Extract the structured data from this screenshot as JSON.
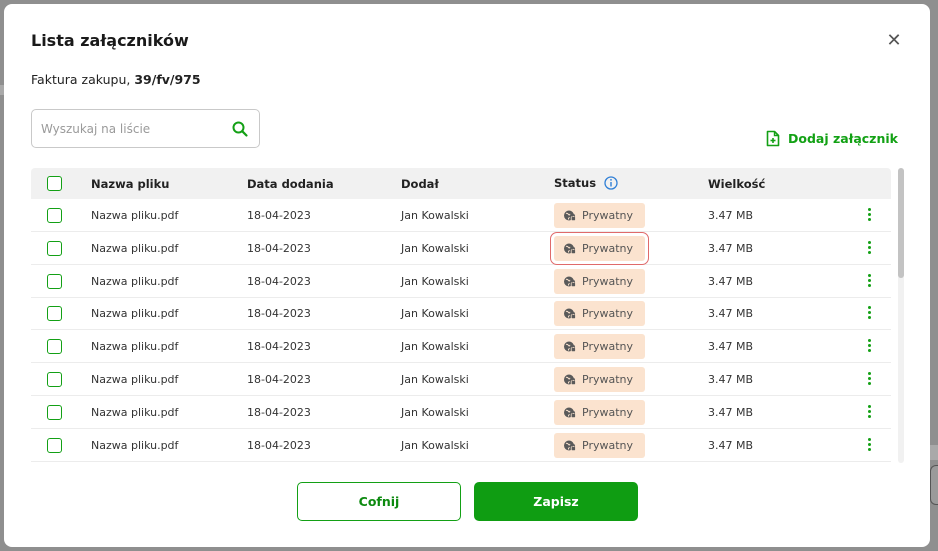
{
  "modal": {
    "title": "Lista załączników",
    "close_glyph": "✕",
    "subtitle_prefix": "Faktura zakupu,",
    "subtitle_number": "39/fv/975"
  },
  "search": {
    "placeholder": "Wyszukaj na liście",
    "value": "",
    "icon": "search-icon"
  },
  "add_attachment": {
    "label": "Dodaj załącznik",
    "icon": "file-plus-icon"
  },
  "colors": {
    "accent": "#0f9d12",
    "badge_bg": "#fbe3cf",
    "selection_outline": "#e06a6a"
  },
  "table": {
    "columns": {
      "select": "",
      "name": "Nazwa pliku",
      "date": "Data dodania",
      "added_by": "Dodał",
      "status": "Status",
      "size": "Wielkość"
    },
    "rows": [
      {
        "name": "Nazwa pliku.pdf",
        "date": "18-04-2023",
        "added_by": "Jan Kowalski",
        "status": "Prywatny",
        "size": "3.47 MB"
      },
      {
        "name": "Nazwa pliku.pdf",
        "date": "18-04-2023",
        "added_by": "Jan Kowalski",
        "status": "Prywatny",
        "size": "3.47 MB"
      },
      {
        "name": "Nazwa pliku.pdf",
        "date": "18-04-2023",
        "added_by": "Jan Kowalski",
        "status": "Prywatny",
        "size": "3.47 MB"
      },
      {
        "name": "Nazwa pliku.pdf",
        "date": "18-04-2023",
        "added_by": "Jan Kowalski",
        "status": "Prywatny",
        "size": "3.47 MB"
      },
      {
        "name": "Nazwa pliku.pdf",
        "date": "18-04-2023",
        "added_by": "Jan Kowalski",
        "status": "Prywatny",
        "size": "3.47 MB"
      },
      {
        "name": "Nazwa pliku.pdf",
        "date": "18-04-2023",
        "added_by": "Jan Kowalski",
        "status": "Prywatny",
        "size": "3.47 MB"
      },
      {
        "name": "Nazwa pliku.pdf",
        "date": "18-04-2023",
        "added_by": "Jan Kowalski",
        "status": "Prywatny",
        "size": "3.47 MB"
      },
      {
        "name": "Nazwa pliku.pdf",
        "date": "18-04-2023",
        "added_by": "Jan Kowalski",
        "status": "Prywatny",
        "size": "3.47 MB"
      }
    ]
  },
  "footer": {
    "back_label": "Cofnij",
    "save_label": "Zapisz"
  }
}
